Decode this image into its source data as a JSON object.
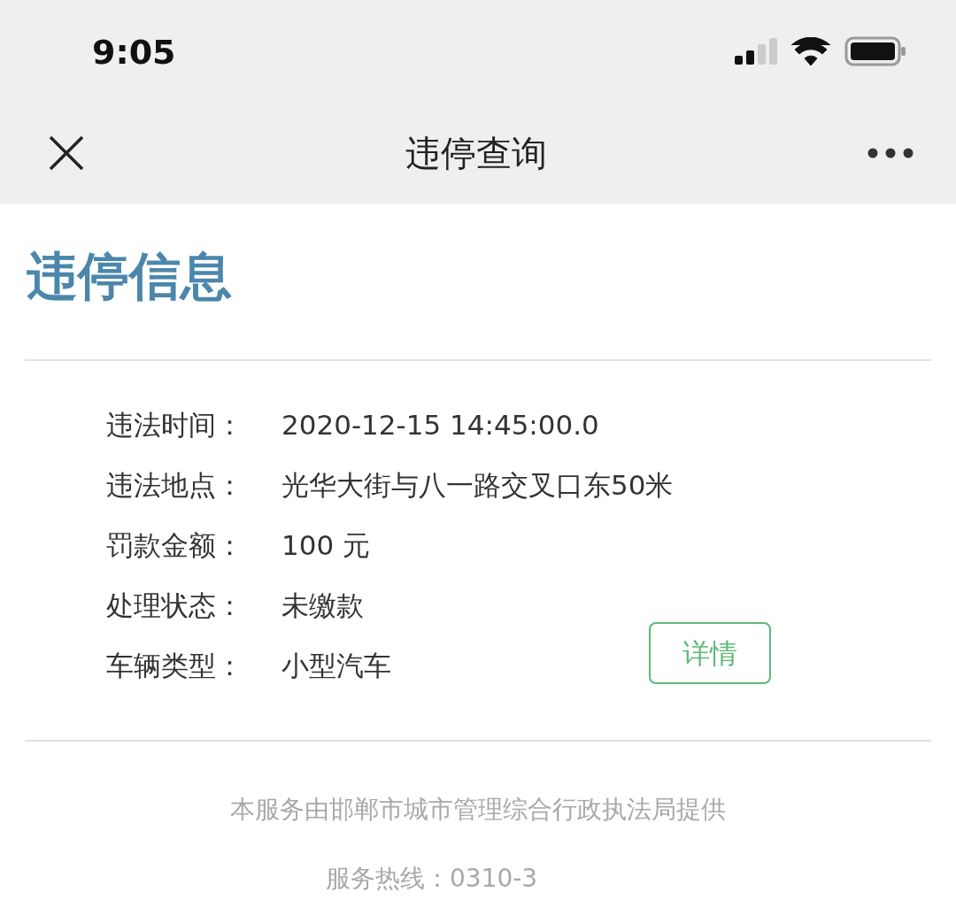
{
  "status_bar": {
    "time": "9:05"
  },
  "nav_bar": {
    "title": "违停查询"
  },
  "heading": "违停信息",
  "fields": [
    {
      "label": "违法时间：",
      "value": "2020-12-15 14:45:00.0"
    },
    {
      "label": "违法地点：",
      "value": "光华大街与八一路交叉口东50米"
    },
    {
      "label": "罚款金额：",
      "value": "100 元"
    },
    {
      "label": "处理状态：",
      "value": "未缴款"
    },
    {
      "label": "车辆类型：",
      "value": "小型汽车"
    }
  ],
  "details_button": "详情",
  "footer": {
    "provider": "本服务由邯郸市城市管理综合行政执法局提供",
    "hotline": "服务热线：0310-3"
  }
}
